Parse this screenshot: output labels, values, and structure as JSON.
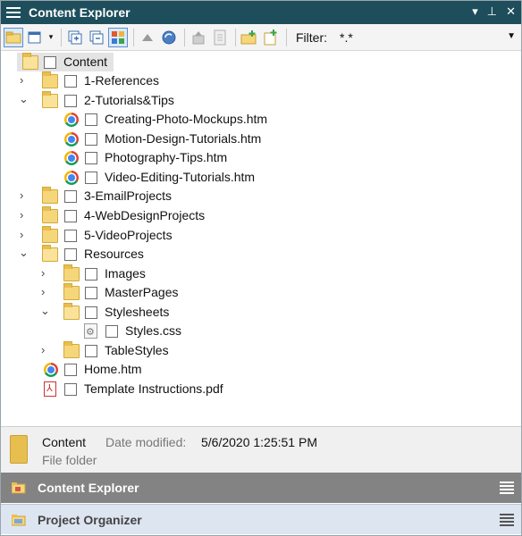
{
  "window": {
    "title": "Content Explorer"
  },
  "toolbar": {
    "filter_label": "Filter:",
    "filter_value": "*.*"
  },
  "tree": {
    "root": "Content",
    "items": [
      {
        "label": "1-References",
        "type": "folder"
      },
      {
        "label": "2-Tutorials&Tips",
        "type": "folder-open"
      },
      {
        "label": "Creating-Photo-Mockups.htm",
        "type": "htm"
      },
      {
        "label": "Motion-Design-Tutorials.htm",
        "type": "htm"
      },
      {
        "label": "Photography-Tips.htm",
        "type": "htm"
      },
      {
        "label": "Video-Editing-Tutorials.htm",
        "type": "htm"
      },
      {
        "label": "3-EmailProjects",
        "type": "folder"
      },
      {
        "label": "4-WebDesignProjects",
        "type": "folder"
      },
      {
        "label": "5-VideoProjects",
        "type": "folder"
      },
      {
        "label": "Resources",
        "type": "folder-open"
      },
      {
        "label": "Images",
        "type": "folder"
      },
      {
        "label": "MasterPages",
        "type": "folder"
      },
      {
        "label": "Stylesheets",
        "type": "folder-open"
      },
      {
        "label": "Styles.css",
        "type": "css"
      },
      {
        "label": "TableStyles",
        "type": "folder"
      },
      {
        "label": "Home.htm",
        "type": "htm"
      },
      {
        "label": "Template Instructions.pdf",
        "type": "pdf"
      }
    ]
  },
  "details": {
    "name": "Content",
    "date_modified_label": "Date modified:",
    "date_modified_value": "5/6/2020   1:25:51 PM",
    "type": "File folder"
  },
  "tabs": [
    {
      "label": "Content Explorer",
      "active": true
    },
    {
      "label": "Project Organizer",
      "active": false
    }
  ],
  "colors": {
    "titlebar": "#1e4e5c",
    "active_tab": "#838383",
    "inactive_tab": "#dde5f0"
  }
}
